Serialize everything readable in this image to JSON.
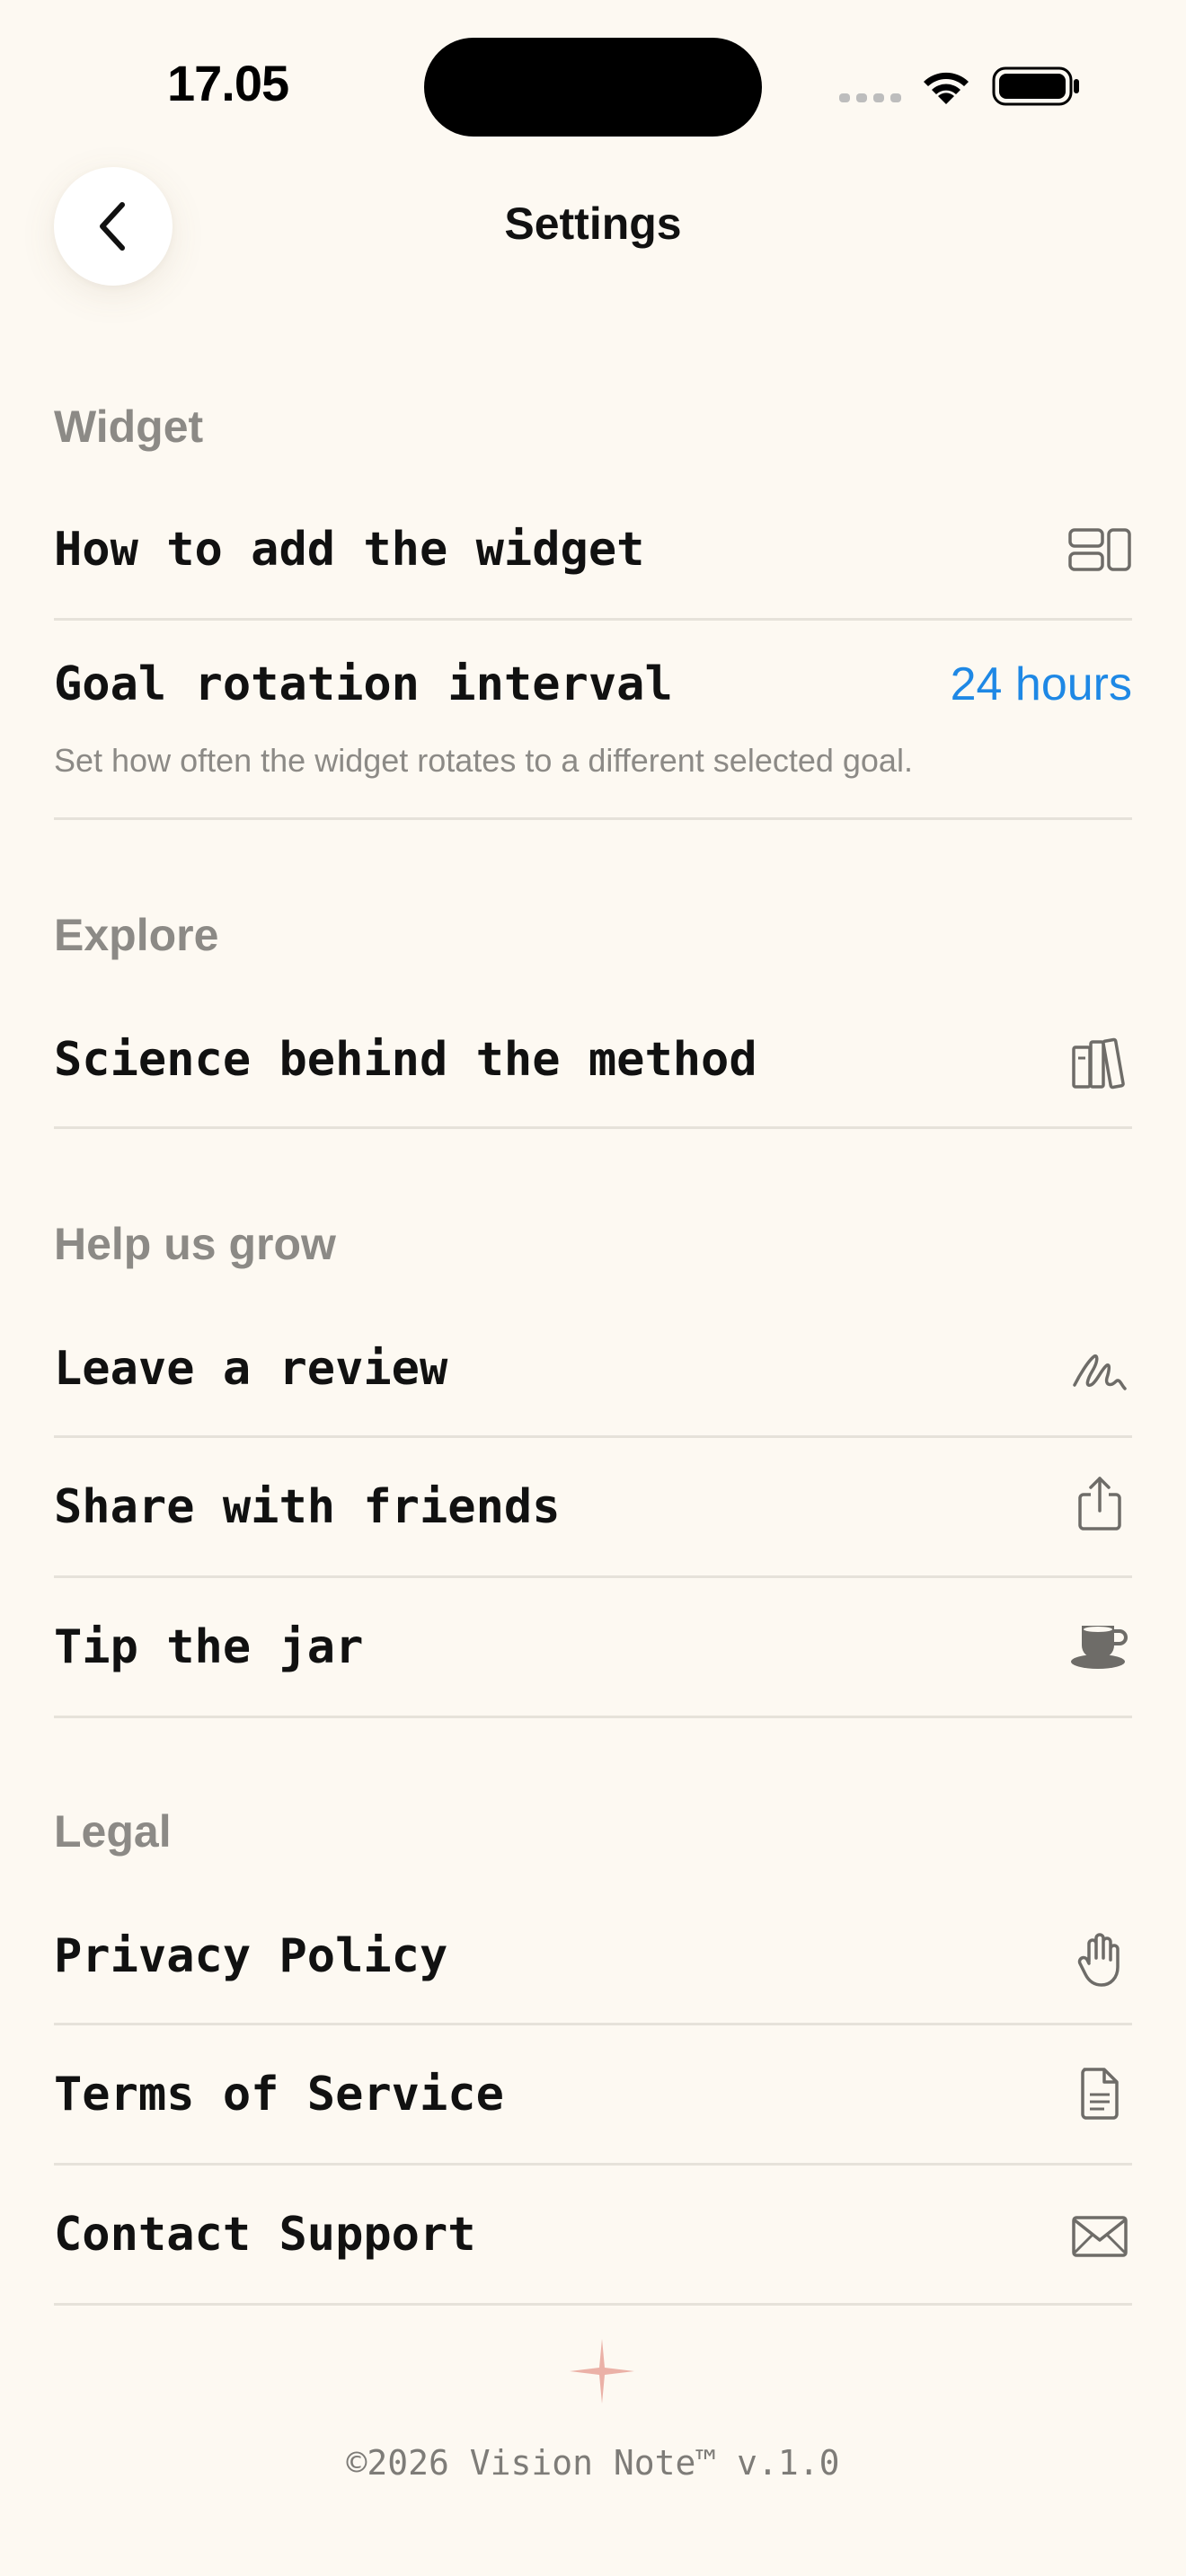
{
  "status_bar": {
    "time": "17.05",
    "icons": [
      "cellular-signal-icon",
      "wifi-icon",
      "battery-icon"
    ]
  },
  "nav": {
    "title": "Settings",
    "back_icon": "chevron-left-icon"
  },
  "sections": {
    "widget": {
      "header": "Widget",
      "how_to_add": {
        "label": "How to add the widget",
        "icon": "widget-layout-icon"
      },
      "goal_rotation": {
        "label": "Goal rotation interval",
        "value": "24 hours",
        "description": "Set how often the widget rotates to a different selected goal."
      }
    },
    "explore": {
      "header": "Explore",
      "science": {
        "label": "Science behind the method",
        "icon": "books-icon"
      }
    },
    "help": {
      "header": "Help us grow",
      "review": {
        "label": "Leave a review",
        "icon": "signature-icon"
      },
      "share": {
        "label": "Share with friends",
        "icon": "share-icon"
      },
      "tip": {
        "label": "Tip the jar",
        "icon": "coffee-cup-icon"
      }
    },
    "legal": {
      "header": "Legal",
      "privacy": {
        "label": "Privacy Policy",
        "icon": "hand-icon"
      },
      "terms": {
        "label": "Terms of Service",
        "icon": "document-icon"
      },
      "contact": {
        "label": "Contact Support",
        "icon": "envelope-icon"
      }
    }
  },
  "footer": {
    "icon": "sparkle-icon",
    "text": "©2026 Vision Note™ v.1.0"
  },
  "colors": {
    "background": "#FDF9F2",
    "accent": "#1E88E5",
    "section_header": "#8C8A86",
    "divider": "#E6E2DA",
    "sparkle": "#E8A49A"
  }
}
